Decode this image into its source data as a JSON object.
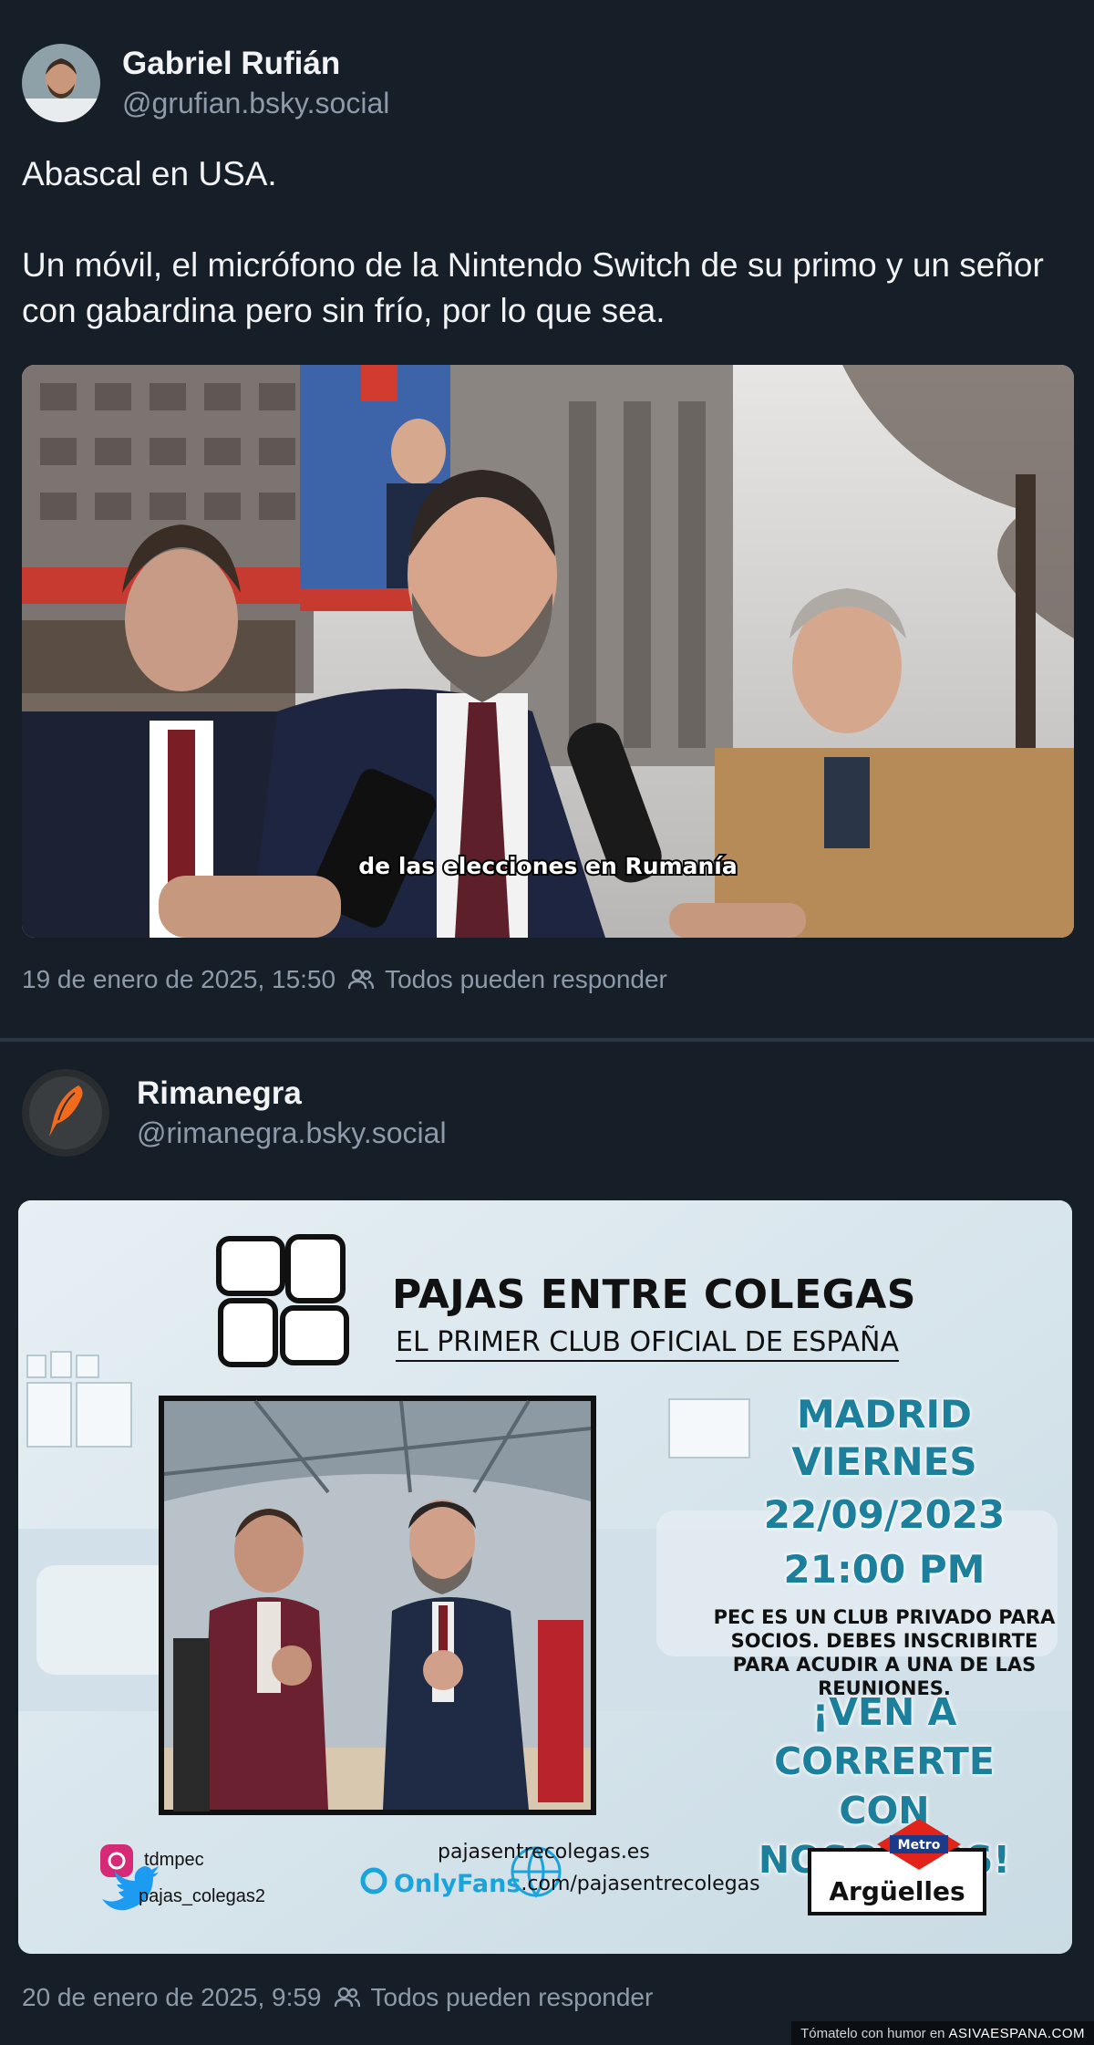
{
  "posts": [
    {
      "author": {
        "name": "Gabriel Rufián",
        "handle": "@grufian.bsky.social"
      },
      "text": [
        "Abascal en USA.",
        "Un móvil, el micrófono de la Nintendo Switch de su primo y un señor con gabardina pero sin frío, por lo que sea."
      ],
      "media": {
        "caption": "de las elecciones en Rumanía"
      },
      "timestamp": "19 de enero de 2025, 15:50",
      "reply_setting": "Todos pueden responder",
      "icons": {
        "reply_setting": "users-icon"
      }
    },
    {
      "author": {
        "name": "Rimanegra",
        "handle": "@rimanegra.bsky.social"
      },
      "poster": {
        "title": "PAJAS ENTRE COLEGAS",
        "subtitle": "EL PRIMER CLUB OFICIAL DE ESPAÑA",
        "city": "MADRID",
        "day": "VIERNES",
        "date": "22/09/2023",
        "time": "21:00 PM",
        "note": "PEC ES UN CLUB PRIVADO PARA SOCIOS. DEBES INSCRIBIRTE PARA ACUDIR A UNA DE LAS REUNIONES.",
        "cta_line1": "¡VEN A CORRERTE",
        "cta_line2": "CON NOSOTROS!",
        "instagram": "tdmpec",
        "twitter": "pajas_colegas2",
        "website": "pajasentrecolegas.es",
        "onlyfans_brand": "OnlyFans",
        "onlyfans_path": ".com/pajasentrecolegas",
        "metro_label": "Metro",
        "metro_station": "Argüelles"
      },
      "timestamp": "20 de enero de 2025, 9:59",
      "reply_setting": "Todos pueden responder"
    }
  ],
  "watermark": {
    "prefix": "Tómatelo con humor en",
    "brand": "ASIVAESPANA.COM"
  },
  "colors": {
    "background": "#161e27",
    "muted": "#8d9aaa",
    "poster_accent": "#1c7f9c"
  }
}
